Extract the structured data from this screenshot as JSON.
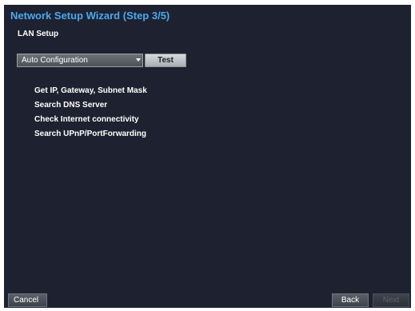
{
  "window": {
    "title": "Network Setup Wizard (Step 3/5)"
  },
  "section": {
    "title": "LAN Setup"
  },
  "configuration": {
    "selected": "Auto Configuration",
    "test_label": "Test"
  },
  "steps": [
    "Get IP, Gateway, Subnet Mask",
    "Search DNS Server",
    "Check Internet connectivity",
    "Search UPnP/PortForwarding"
  ],
  "footer": {
    "cancel_label": "Cancel",
    "back_label": "Back",
    "next_label": "Next",
    "next_enabled": false
  },
  "colors": {
    "background": "#1e2230",
    "title": "#4aa8f0",
    "text": "#ffffff"
  }
}
